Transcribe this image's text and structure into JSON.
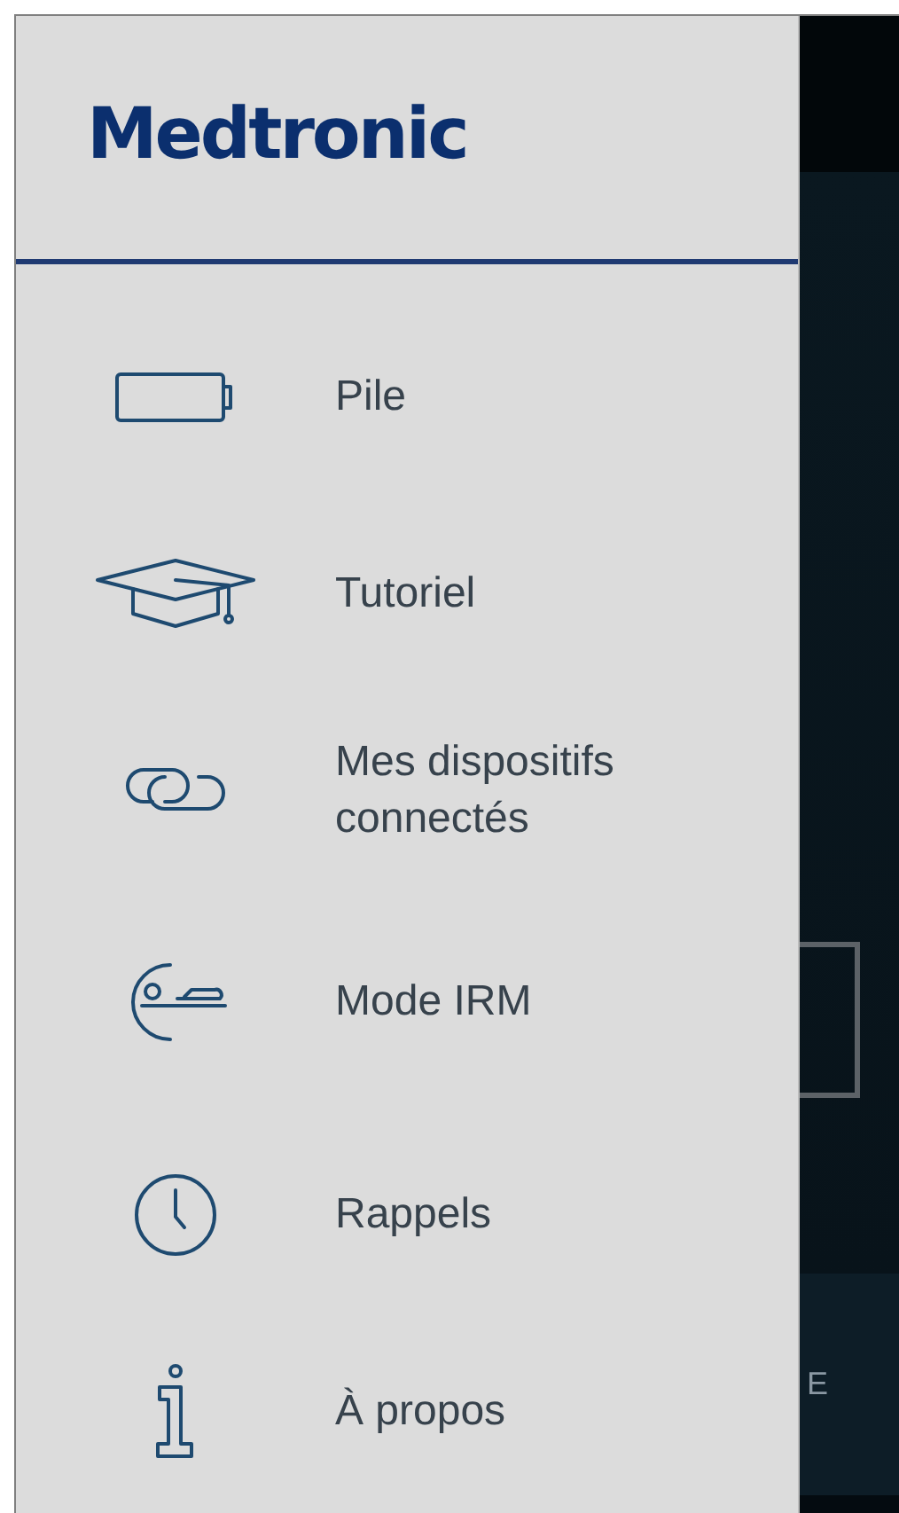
{
  "app_behind": {
    "bottom_bar": {
      "label_fragment": "E"
    }
  },
  "drawer": {
    "logo": "Medtronic",
    "items": [
      {
        "label": "Pile"
      },
      {
        "label": "Tutoriel"
      },
      {
        "label": "Mes dispositifs connectés"
      },
      {
        "label": "Mode IRM"
      },
      {
        "label": "Rappels"
      },
      {
        "label": "À propos"
      }
    ]
  }
}
